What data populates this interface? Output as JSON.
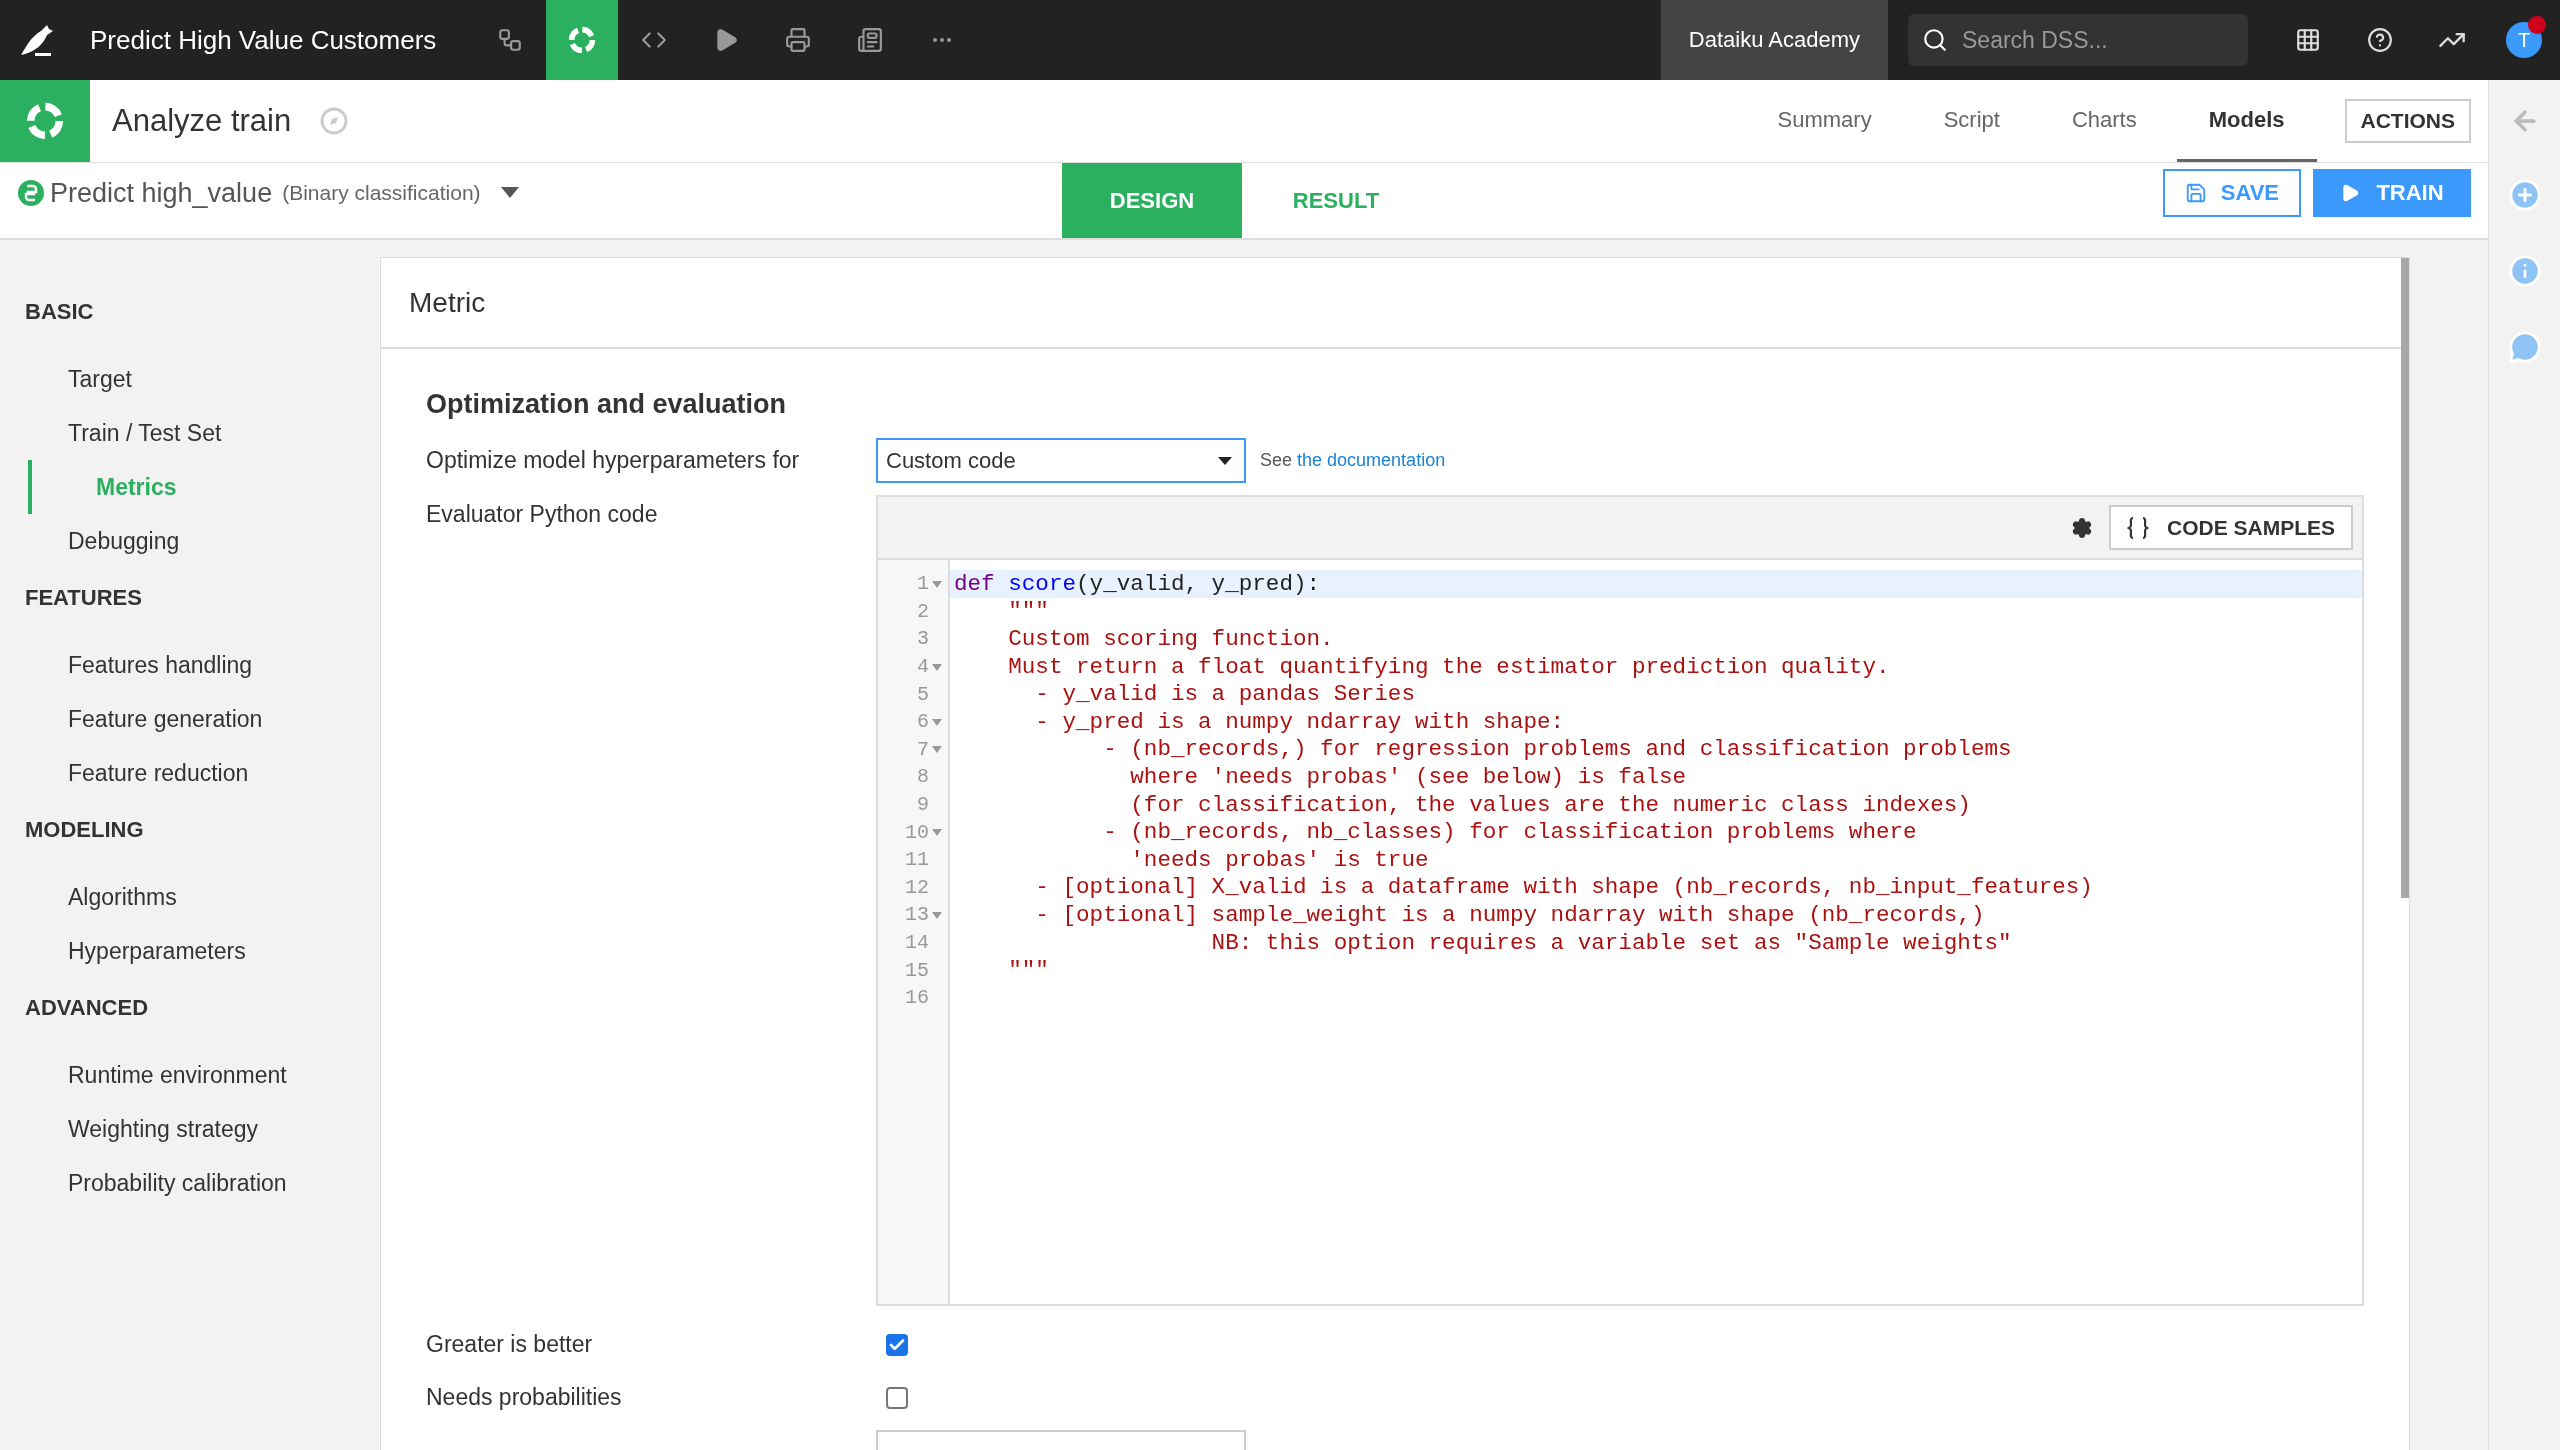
{
  "topbar": {
    "project_title": "Predict High Value Customers",
    "nav_icons": [
      {
        "kind": "flow",
        "selected": false
      },
      {
        "kind": "lab",
        "selected": true
      },
      {
        "kind": "code",
        "selected": false
      },
      {
        "kind": "run",
        "selected": false
      },
      {
        "kind": "deploy",
        "selected": false
      },
      {
        "kind": "dashboard",
        "selected": false
      },
      {
        "kind": "more",
        "selected": false
      }
    ],
    "instance": "Dataiku Academy",
    "search": {
      "placeholder": "Search DSS..."
    },
    "avatar": "T",
    "notification": true
  },
  "header": {
    "title": "Analyze train",
    "tabs": [
      {
        "label": "Summary",
        "selected": false
      },
      {
        "label": "Script",
        "selected": false
      },
      {
        "label": "Charts",
        "selected": false
      },
      {
        "label": "Models",
        "selected": true
      }
    ],
    "actions": "ACTIONS"
  },
  "task": {
    "title": "Predict high_value",
    "subtitle": "(Binary classification)",
    "tabs": [
      {
        "label": "DESIGN",
        "selected": true
      },
      {
        "label": "RESULT",
        "selected": false
      }
    ],
    "save": "SAVE",
    "train": "TRAIN"
  },
  "sidebar": {
    "sections": [
      {
        "title": "BASIC",
        "items": [
          {
            "label": "Target",
            "selected": false
          },
          {
            "label": "Train / Test Set",
            "selected": false
          },
          {
            "label": "Metrics",
            "selected": true
          },
          {
            "label": "Debugging",
            "selected": false
          }
        ]
      },
      {
        "title": "FEATURES",
        "items": [
          {
            "label": "Features handling",
            "selected": false
          },
          {
            "label": "Feature generation",
            "selected": false
          },
          {
            "label": "Feature reduction",
            "selected": false
          }
        ]
      },
      {
        "title": "MODELING",
        "items": [
          {
            "label": "Algorithms",
            "selected": false
          },
          {
            "label": "Hyperparameters",
            "selected": false
          }
        ]
      },
      {
        "title": "ADVANCED",
        "items": [
          {
            "label": "Runtime environment",
            "selected": false
          },
          {
            "label": "Weighting strategy",
            "selected": false
          },
          {
            "label": "Probability calibration",
            "selected": false
          }
        ]
      }
    ]
  },
  "panel": {
    "title": "Metric",
    "section_title": "Optimization and evaluation",
    "metric_label": "Optimize model hyperparameters for",
    "metric_select": {
      "value": "Custom code"
    },
    "doc_prefix": "See",
    "doc_link": "the documentation",
    "code_label": "Evaluator Python code",
    "code_samples": "CODE SAMPLES",
    "code_lines": [
      {
        "number": "1",
        "foldable": true,
        "active": true,
        "tokens": [
          {
            "kind": "keyword",
            "text": "def "
          },
          {
            "kind": "def",
            "text": "score"
          },
          {
            "kind": "plain",
            "text": "(y_valid, y_pred):"
          }
        ]
      },
      {
        "number": "2",
        "foldable": false,
        "active": false,
        "tokens": [
          {
            "kind": "string",
            "text": "    \"\"\""
          }
        ]
      },
      {
        "number": "3",
        "foldable": false,
        "active": false,
        "tokens": [
          {
            "kind": "string",
            "text": "    Custom scoring function."
          }
        ]
      },
      {
        "number": "4",
        "foldable": true,
        "active": false,
        "tokens": [
          {
            "kind": "string",
            "text": "    Must return a float quantifying the estimator prediction quality."
          }
        ]
      },
      {
        "number": "5",
        "foldable": false,
        "active": false,
        "tokens": [
          {
            "kind": "string",
            "text": "      - y_valid is a pandas Series"
          }
        ]
      },
      {
        "number": "6",
        "foldable": true,
        "active": false,
        "tokens": [
          {
            "kind": "string",
            "text": "      - y_pred is a numpy ndarray with shape:"
          }
        ]
      },
      {
        "number": "7",
        "foldable": true,
        "active": false,
        "tokens": [
          {
            "kind": "string",
            "text": "           - (nb_records,) for regression problems and classification problems"
          }
        ]
      },
      {
        "number": "8",
        "foldable": false,
        "active": false,
        "tokens": [
          {
            "kind": "string",
            "text": "             where 'needs probas' (see below) is false"
          }
        ]
      },
      {
        "number": "9",
        "foldable": false,
        "active": false,
        "tokens": [
          {
            "kind": "string",
            "text": "             (for classification, the values are the numeric class indexes)"
          }
        ]
      },
      {
        "number": "10",
        "foldable": true,
        "active": false,
        "tokens": [
          {
            "kind": "string",
            "text": "           - (nb_records, nb_classes) for classification problems where"
          }
        ]
      },
      {
        "number": "11",
        "foldable": false,
        "active": false,
        "tokens": [
          {
            "kind": "string",
            "text": "             'needs probas' is true"
          }
        ]
      },
      {
        "number": "12",
        "foldable": false,
        "active": false,
        "tokens": [
          {
            "kind": "string",
            "text": "      - [optional] X_valid is a dataframe with shape (nb_records, nb_input_features)"
          }
        ]
      },
      {
        "number": "13",
        "foldable": true,
        "active": false,
        "tokens": [
          {
            "kind": "string",
            "text": "      - [optional] sample_weight is a numpy ndarray with shape (nb_records,)"
          }
        ]
      },
      {
        "number": "14",
        "foldable": false,
        "active": false,
        "tokens": [
          {
            "kind": "string",
            "text": "                   NB: this option requires a variable set as \"Sample weights\""
          }
        ]
      },
      {
        "number": "15",
        "foldable": false,
        "active": false,
        "tokens": [
          {
            "kind": "string",
            "text": "    \"\"\""
          }
        ]
      },
      {
        "number": "16",
        "foldable": false,
        "active": false
      }
    ],
    "options": [
      {
        "label": "Greater is better",
        "checked": true
      },
      {
        "label": "Needs probabilities",
        "checked": false
      }
    ]
  }
}
